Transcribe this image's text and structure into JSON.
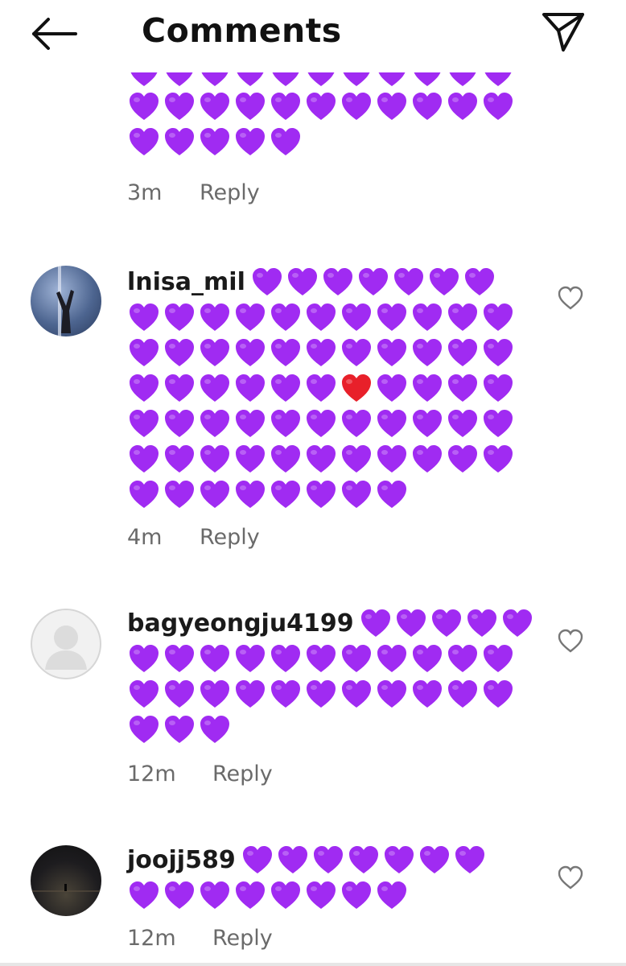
{
  "header": {
    "title": "Comments",
    "back_icon": "arrow-left-icon",
    "send_icon": "paper-plane-icon"
  },
  "colors": {
    "purple_heart": "#a02bf2",
    "red_heart": "#e8202a",
    "text": "#111111",
    "meta": "#6a6a6a"
  },
  "comments": [
    {
      "username": "",
      "time": "3m",
      "reply_label": "Reply",
      "partial_top": true
    },
    {
      "username": "lnisa_mil",
      "time": "4m",
      "reply_label": "Reply",
      "hearts_line1": 7,
      "hearts_lines": [
        11,
        11,
        11,
        11,
        11,
        8
      ],
      "red_heart": {
        "line": 3,
        "index": 6
      }
    },
    {
      "username": "bagyeongju4199",
      "time": "12m",
      "reply_label": "Reply",
      "hearts_line1": 5,
      "hearts_lines": [
        11,
        11,
        3
      ]
    },
    {
      "username": "joojj589",
      "time": "12m",
      "reply_label": "Reply",
      "hearts_line1": 7,
      "hearts_lines": [
        8
      ]
    }
  ]
}
